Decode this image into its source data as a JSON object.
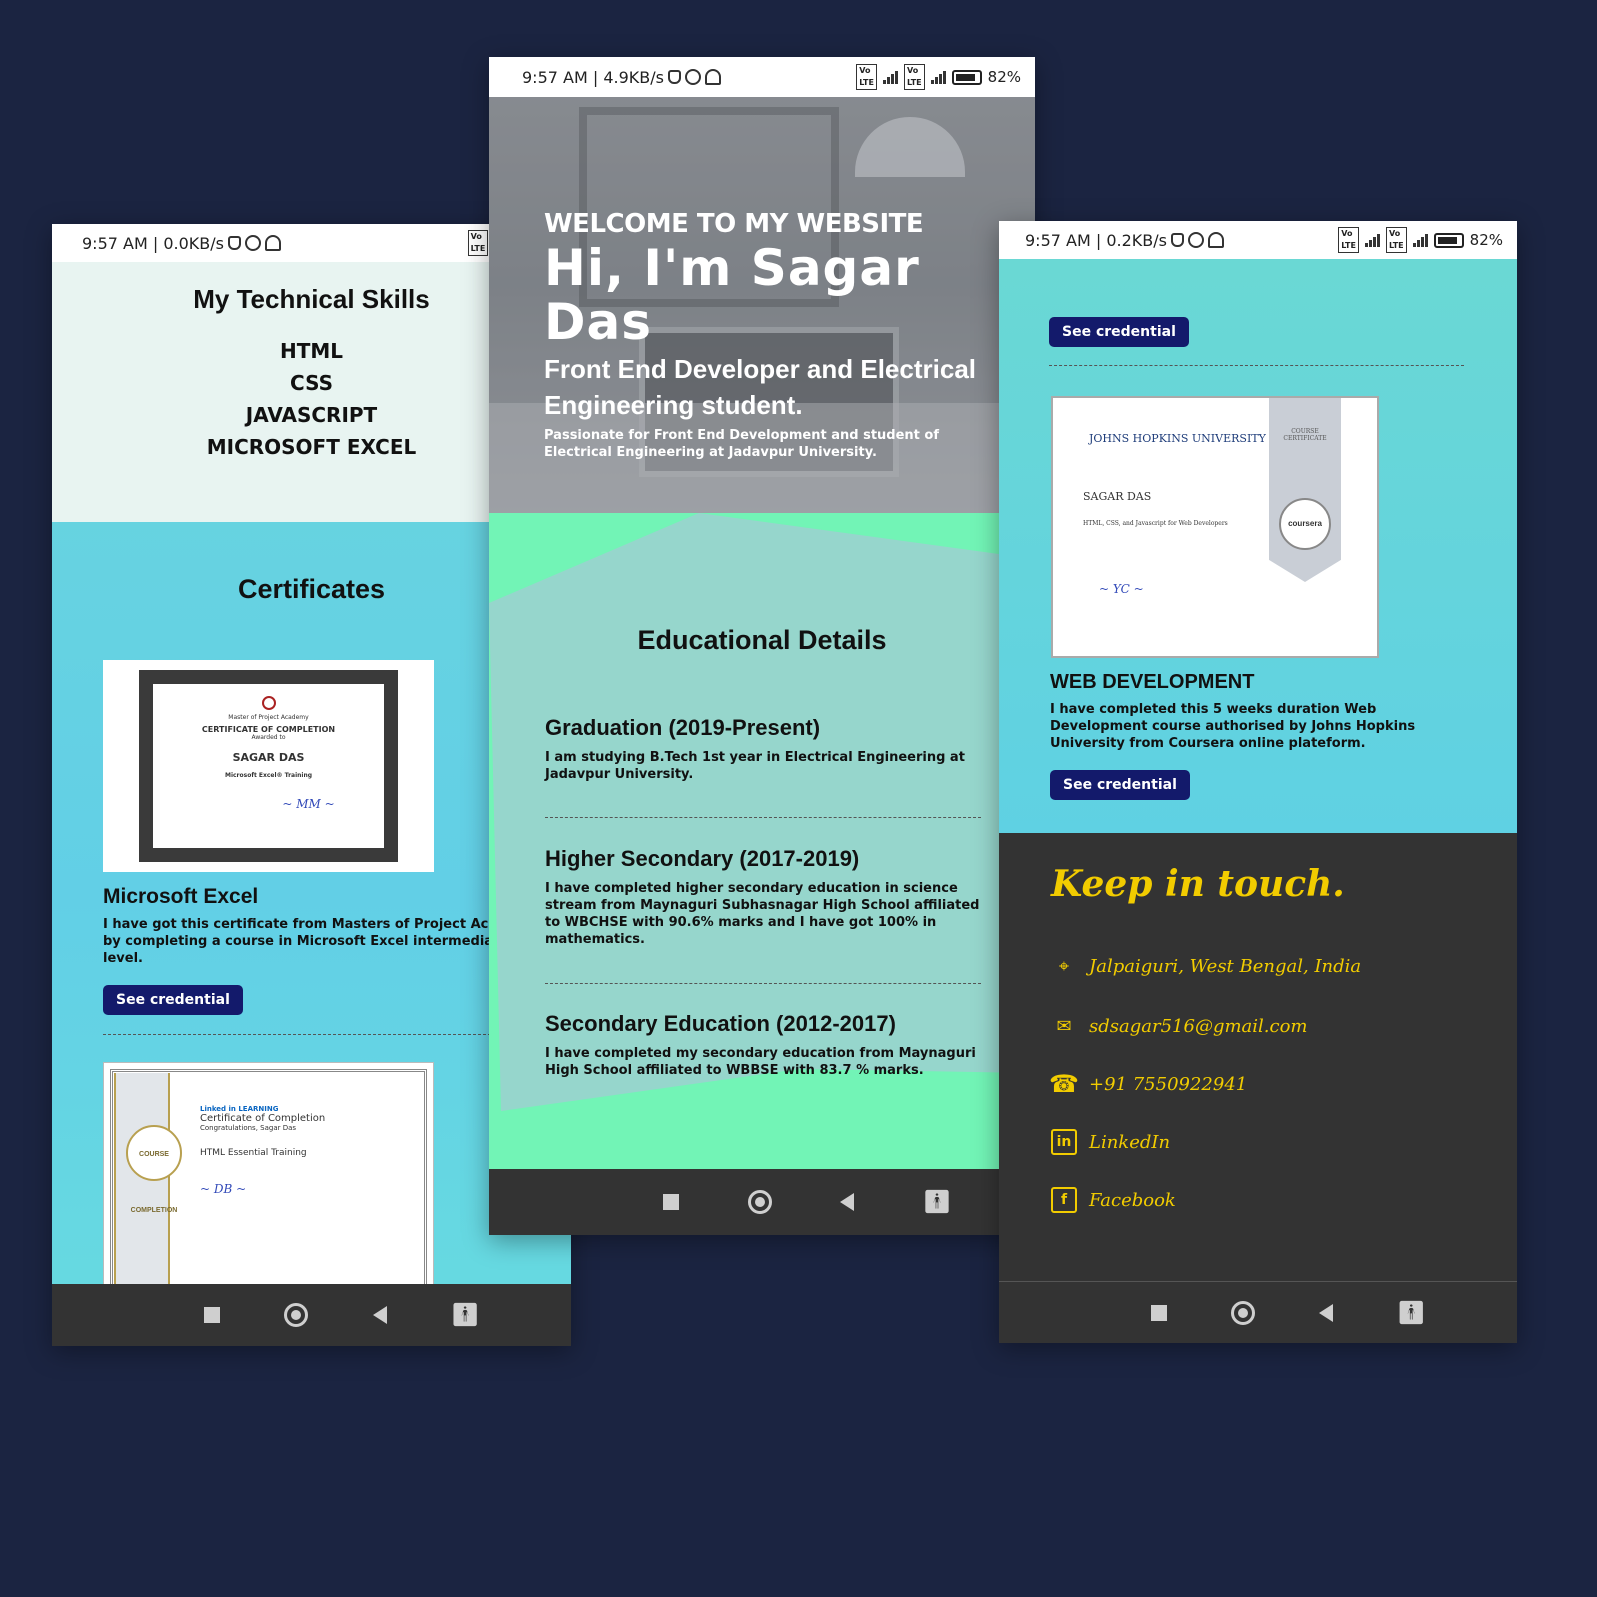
{
  "left_phone": {
    "status": {
      "time": "9:57 AM | 0.0KB/s"
    },
    "skills": {
      "title": "My Technical Skills",
      "items": [
        "HTML",
        "CSS",
        "JAVASCRIPT",
        "MICROSOFT EXCEL"
      ]
    },
    "certificates": {
      "title": "Certificates",
      "excel_cert": {
        "academy": "Master of Project Academy",
        "heading": "CERTIFICATE OF COMPLETION",
        "awarded_to": "Awarded to",
        "name": "SAGAR DAS",
        "program": "Microsoft Excel® Training"
      },
      "excel": {
        "title": "Microsoft Excel",
        "desc_line1": "I have got this certificate from Masters of Project Acade",
        "desc_line2": "by completing a course in Microsoft Excel intermediate",
        "desc_line3": "level.",
        "button": "See credential"
      },
      "linkedin_cert": {
        "brand": "Linked in LEARNING",
        "heading": "Certificate of Completion",
        "congrats": "Congratulations, Sagar Das",
        "course": "HTML Essential Training",
        "badge": "COURSE COMPLETION"
      }
    }
  },
  "center_phone": {
    "status": {
      "time": "9:57 AM | 4.9KB/s",
      "battery": "82%"
    },
    "hero": {
      "welcome": "WELCOME TO MY WEBSITE",
      "headline": "Hi, I'm Sagar Das",
      "role": "Front End Developer and Electrical Engineering student.",
      "passion": "Passionate for Front End Development and student of Electrical Engineering at Jadavpur University."
    },
    "education": {
      "title": "Educational Details",
      "items": [
        {
          "title": "Graduation (2019-Present)",
          "desc": "I am studying B.Tech 1st year in Electrical Engineering at Jadavpur University."
        },
        {
          "title": "Higher Secondary (2017-2019)",
          "desc": "I have completed higher secondary education in science stream from Maynaguri Subhasnagar High School affiliated to WBCHSE with 90.6% marks and I have got 100% in mathematics."
        },
        {
          "title": "Secondary Education (2012-2017)",
          "desc": "I have completed my secondary education from Maynaguri High School affiliated to WBBSE with 83.7 % marks."
        }
      ]
    }
  },
  "right_phone": {
    "status": {
      "time": "9:57 AM | 0.2KB/s",
      "battery": "82%"
    },
    "button_top": "See credential",
    "jh_cert": {
      "institution": "JOHNS HOPKINS UNIVERSITY",
      "ribbon": "COURSE CERTIFICATE",
      "name": "SAGAR DAS",
      "course": "HTML, CSS, and Javascript for Web Developers",
      "seal": "coursera"
    },
    "webdev": {
      "title": "WEB DEVELOPMENT",
      "desc": "I have completed this 5 weeks duration Web Development course authorised by Johns Hopkins University from Coursera online plateform.",
      "button": "See credential"
    },
    "contact": {
      "title": "Keep in touch.",
      "location": "Jalpaiguri, West Bengal, India",
      "email": "sdsagar516@gmail.com",
      "phone": "+91 7550922941",
      "linkedin": "LinkedIn",
      "facebook": "Facebook"
    }
  },
  "colors": {
    "background": "#1b2441",
    "button": "#131a6b",
    "accent_green": "#72f4b6",
    "accent_teal": "#62cfe6",
    "contact_yellow": "#f2cc00"
  }
}
